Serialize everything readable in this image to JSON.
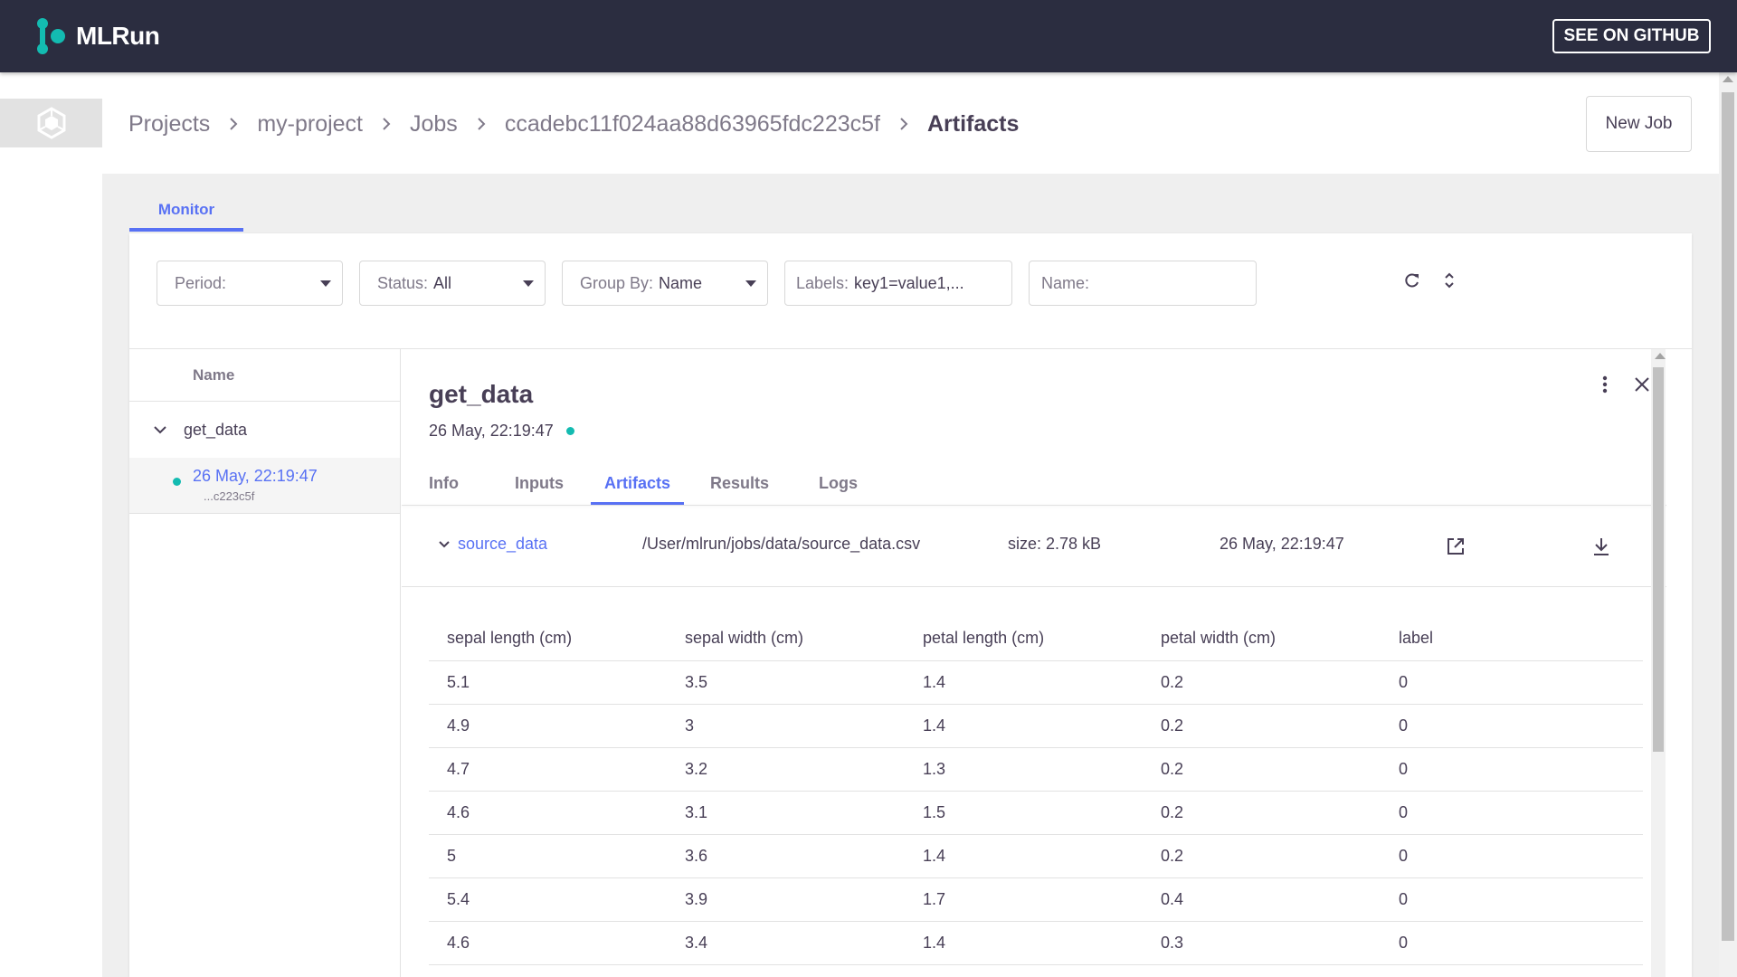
{
  "header": {
    "brand": "MLRun",
    "github_button": "SEE ON GITHUB"
  },
  "breadcrumbs": {
    "items": [
      "Projects",
      "my-project",
      "Jobs",
      "ccadebc11f024aa88d63965fdc223c5f",
      "Artifacts"
    ]
  },
  "new_job_button": "New Job",
  "tabs": {
    "monitor": "Monitor"
  },
  "filters": {
    "period_label": "Period:",
    "status_label": "Status:",
    "status_value": "All",
    "group_label": "Group By:",
    "group_value": "Name",
    "labels_label": "Labels:",
    "labels_value": "key1=value1,...",
    "name_label": "Name:",
    "name_value": ""
  },
  "list": {
    "header": "Name",
    "group_name": "get_data",
    "item_date": "26 May, 22:19:47",
    "item_uid": "...c223c5f"
  },
  "details": {
    "title": "get_data",
    "date": "26 May, 22:19:47",
    "tabs": [
      "Info",
      "Inputs",
      "Artifacts",
      "Results",
      "Logs"
    ],
    "active_tab": "Artifacts",
    "artifact": {
      "name": "source_data",
      "path": "/User/mlrun/jobs/data/source_data.csv",
      "size": "size: 2.78 kB",
      "date": "26 May, 22:19:47"
    },
    "table": {
      "columns": [
        "sepal length (cm)",
        "sepal width (cm)",
        "petal length (cm)",
        "petal width (cm)",
        "label"
      ],
      "rows": [
        [
          "5.1",
          "3.5",
          "1.4",
          "0.2",
          "0"
        ],
        [
          "4.9",
          "3",
          "1.4",
          "0.2",
          "0"
        ],
        [
          "4.7",
          "3.2",
          "1.3",
          "0.2",
          "0"
        ],
        [
          "4.6",
          "3.1",
          "1.5",
          "0.2",
          "0"
        ],
        [
          "5",
          "3.6",
          "1.4",
          "0.2",
          "0"
        ],
        [
          "5.4",
          "3.9",
          "1.7",
          "0.4",
          "0"
        ],
        [
          "4.6",
          "3.4",
          "1.4",
          "0.3",
          "0"
        ]
      ]
    }
  },
  "colors": {
    "header_bg": "#2b2d40",
    "accent": "#5871f4",
    "status_green": "#13bbb1",
    "text": "#483f56",
    "muted": "#7f7989"
  },
  "icons": {
    "logo": "mlrun-logo-icon",
    "project": "project-hexagon-icon",
    "refresh": "refresh-icon",
    "collapse": "expand-collapse-icon",
    "more": "more-vertical-icon",
    "close": "close-icon",
    "open": "open-external-icon",
    "download": "download-icon"
  }
}
